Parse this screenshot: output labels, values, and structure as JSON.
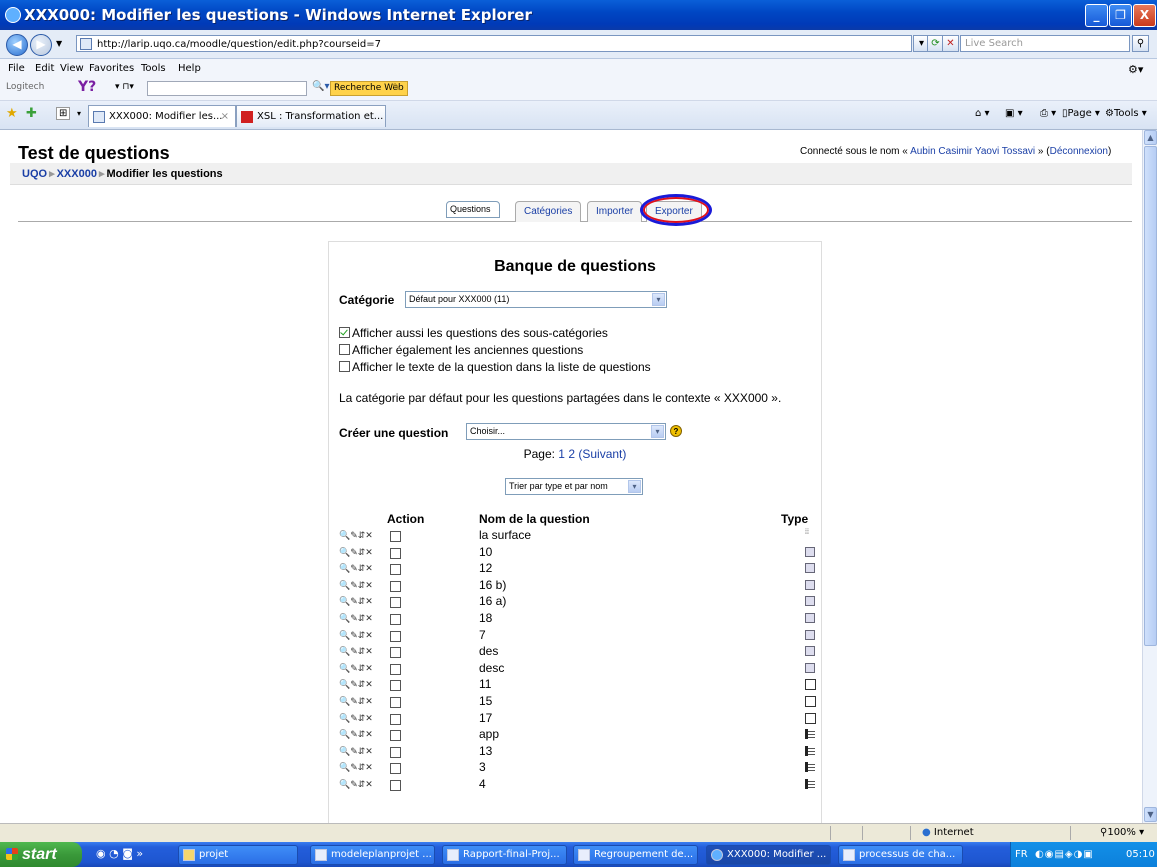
{
  "window": {
    "title": "XXX000: Modifier les questions - Windows Internet Explorer",
    "minimize": "_",
    "maximize": "❐",
    "close": "X"
  },
  "address": {
    "url": "http://larip.uqo.ca/moodle/question/edit.php?courseid=7",
    "search_placeholder": "Live Search"
  },
  "menu": [
    "File",
    "Edit",
    "View",
    "Favorites",
    "Tools",
    "Help"
  ],
  "toolbar": {
    "logitech": "Logitech",
    "recherche_web": "Recherche Web"
  },
  "browser_tabs": [
    {
      "label": "XXX000: Modifier les...",
      "active": true
    },
    {
      "label": "XSL : Transformation et...",
      "active": false
    }
  ],
  "browser_commands": {
    "page": "Page",
    "tools": "Tools"
  },
  "page": {
    "course_title": "Test de questions",
    "login_prefix": "Connecté sous le nom « ",
    "login_user": "Aubin Casimir Yaovi Tossavi",
    "login_mid": " » (",
    "login_logout": "Déconnexion",
    "login_suffix": ")",
    "breadcrumb": [
      "UQO",
      "XXX000",
      "Modifier les questions"
    ]
  },
  "tabs": [
    {
      "label": "Questions",
      "selected": true
    },
    {
      "label": "Catégories",
      "selected": false
    },
    {
      "label": "Importer",
      "selected": false
    },
    {
      "label": "Exporter",
      "selected": false
    }
  ],
  "bank": {
    "title": "Banque de questions",
    "category_label": "Catégorie",
    "category_value": "Défaut pour XXX000 (11)",
    "options": [
      {
        "label": "Afficher aussi les questions des sous-catégories",
        "checked": true
      },
      {
        "label": "Afficher également les anciennes questions",
        "checked": false
      },
      {
        "label": "Afficher le texte de la question dans la liste de questions",
        "checked": false
      }
    ],
    "default_category_text": "La catégorie par défaut pour les questions partagées dans le contexte « XXX000 ».",
    "create_label": "Créer une question",
    "create_value": "Choisir...",
    "paging_prefix": "Page: ",
    "paging_current": "1",
    "paging_next_page": "2",
    "paging_next": "(Suivant)",
    "sort_value": "Trier par type et par nom",
    "col_action": "Action",
    "col_name": "Nom de la question",
    "col_type": "Type",
    "action_icons": "🔍✎⇵✕",
    "questions": [
      {
        "name": "la surface",
        "type": "dots"
      },
      {
        "name": "10",
        "type": "img"
      },
      {
        "name": "12",
        "type": "img"
      },
      {
        "name": "16 b)",
        "type": "img"
      },
      {
        "name": "16 a)",
        "type": "img"
      },
      {
        "name": "18",
        "type": "img"
      },
      {
        "name": "7",
        "type": "img"
      },
      {
        "name": "des",
        "type": "img"
      },
      {
        "name": "desc",
        "type": "img"
      },
      {
        "name": "11",
        "type": "box"
      },
      {
        "name": "15",
        "type": "box"
      },
      {
        "name": "17",
        "type": "box"
      },
      {
        "name": "app",
        "type": "list"
      },
      {
        "name": "13",
        "type": "list"
      },
      {
        "name": "3",
        "type": "list"
      },
      {
        "name": "4",
        "type": "list"
      }
    ]
  },
  "status": {
    "zone": "Internet",
    "zoom": "100%"
  },
  "taskbar": {
    "start": "start",
    "items": [
      {
        "label": "projet"
      },
      {
        "label": "modeleplanprojet ..."
      },
      {
        "label": "Rapport-final-Proj..."
      },
      {
        "label": "Regroupement de..."
      },
      {
        "label": "XXX000: Modifier ..."
      },
      {
        "label": "processus de cha..."
      }
    ],
    "lang": "FR",
    "clock": "05:10"
  }
}
